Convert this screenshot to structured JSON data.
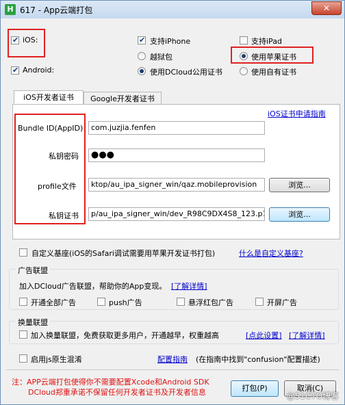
{
  "window": {
    "title": "617 - App云端打包",
    "close_label": "✕",
    "app_icon_letter": "H"
  },
  "platforms": {
    "ios_label": "iOS:",
    "android_label": "Android:",
    "iphone_label": "支持iPhone",
    "ipad_label": "支持iPad",
    "jailbreak_label": "越狱包",
    "apple_cert_label": "使用苹果证书",
    "dcloud_cert_label": "使用DCloud公用证书",
    "own_cert_label": "使用自有证书"
  },
  "tabs": {
    "ios_cert": "iOS开发者证书",
    "google_cert": "Google开发者证书"
  },
  "ios_cert_form": {
    "guide_link": "iOS证书申请指南",
    "bundle_id_label": "Bundle ID(AppID)",
    "bundle_id_value": "com.juzjia.fenfen",
    "key_password_label": "私钥密码",
    "key_password_value": "●●●",
    "profile_label": "profile文件",
    "profile_value": "ktop/au_ipa_signer_win/qaz.mobileprovision",
    "private_cert_label": "私钥证书",
    "private_cert_value": "p/au_ipa_signer_win/dev_R98C9DX4S8_123.p12",
    "browse_label": "浏览..."
  },
  "custom_base": {
    "label": "自定义基座(iOS的Safari调试需要用苹果开发证书打包)",
    "link": "什么是自定义基座?"
  },
  "ad_alliance": {
    "title": "广告联盟",
    "description": "加入DCloud广告联盟，帮助你的App变现。",
    "detail_link": "[了解详情]",
    "options": [
      "开通全部广告",
      "push广告",
      "悬浮红包广告",
      "开屏广告"
    ]
  },
  "exchange_alliance": {
    "title": "换量联盟",
    "label": "加入换量联盟，免费获取更多用户，开通越早，权重越高",
    "settings_link": "[点此设置]",
    "detail_link": "[了解详情]"
  },
  "confusion": {
    "label": "启用js原生混淆",
    "guide_link": "配置指南",
    "guide_text": "(在指南中找到\"confusion\"配置描述)"
  },
  "footer": {
    "note_line1": "注：APP云端打包使得你不需要配置Xcode和Android SDK",
    "note_line2": "DCloud郑重承诺不保留任何开发者证书及开发者信息",
    "pack_button": "打包(P)",
    "cancel_button": "取消(C)",
    "watermark": "@51CTO博客"
  },
  "colors": {
    "highlight_box": "#e02020",
    "link": "#0000cc",
    "note": "#e01010"
  }
}
